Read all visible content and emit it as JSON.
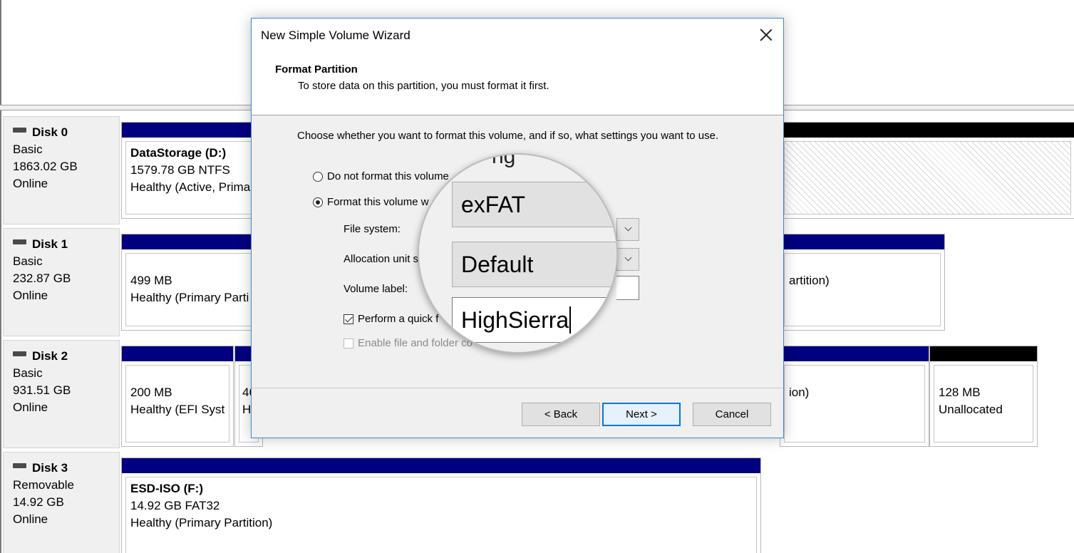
{
  "disks": [
    {
      "name": "Disk 0",
      "type": "Basic",
      "size": "1863.02 GB",
      "status": "Online",
      "partitions": [
        {
          "title": "DataStorage  (D:)",
          "size": "1579.78 GB NTFS",
          "status": "Healthy (Active, Prima"
        },
        {
          "title": "",
          "size": "",
          "status": ""
        }
      ]
    },
    {
      "name": "Disk 1",
      "type": "Basic",
      "size": "232.87 GB",
      "status": "Online",
      "partitions": [
        {
          "size": "499 MB",
          "status": "Healthy (Primary Parti"
        },
        {
          "size": "",
          "status": "artition)"
        }
      ]
    },
    {
      "name": "Disk 2",
      "type": "Basic",
      "size": "931.51 GB",
      "status": "Online",
      "partitions": [
        {
          "size": "200 MB",
          "status": "Healthy (EFI Syst"
        },
        {
          "size": "46",
          "status": "He"
        },
        {
          "size": "",
          "status": "ion)"
        },
        {
          "size": "128 MB",
          "status": "Unallocated"
        }
      ]
    },
    {
      "name": "Disk 3",
      "type": "Removable",
      "size": "14.92 GB",
      "status": "Online",
      "partitions": [
        {
          "title": "ESD-ISO  (F:)",
          "size": "14.92 GB FAT32",
          "status": "Healthy (Primary Partition)"
        }
      ]
    }
  ],
  "wizard": {
    "title": "New Simple Volume Wizard",
    "header_title": "Format Partition",
    "header_subtitle": "To store data on this partition, you must format it first.",
    "intro": "Choose whether you want to format this volume, and if so, what settings you want to use.",
    "option_no_format": "Do not format this volume",
    "option_format": "Format this volume w",
    "file_system_label": "File system:",
    "allocation_label": "Allocation unit s",
    "volume_label_label": "Volume label:",
    "quick_format_label": "Perform a quick f",
    "compression_label": "Enable file and folder co",
    "back_button": "< Back",
    "next_button": "Next >",
    "cancel_button": "Cancel"
  },
  "magnifier": {
    "partial_text": "ng",
    "file_system_value": "exFAT",
    "allocation_value": "Default",
    "volume_label_value": "HighSierra"
  }
}
